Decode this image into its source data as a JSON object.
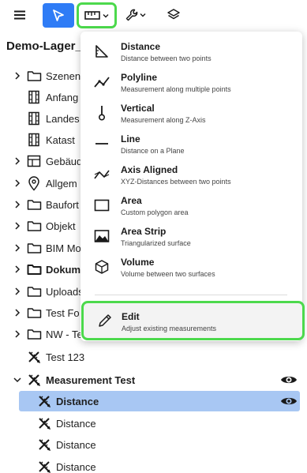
{
  "toolbar": {
    "menu_icon": "hamburger-icon",
    "select_icon": "cursor-arrow-icon",
    "measure_icon": "ruler-icon",
    "tools_icon": "wrench-icon",
    "layers_icon": "layers-icon",
    "accent": "#2f7cf6",
    "highlight": "#4cd94c"
  },
  "project": {
    "title": "Demo-Lager_u"
  },
  "tree": {
    "items": [
      {
        "label": "Szenen",
        "icon": "folder-icon"
      },
      {
        "label": "Anfang",
        "icon": "film-icon"
      },
      {
        "label": "Landes",
        "icon": "film-icon"
      },
      {
        "label": "Katast",
        "icon": "film-icon"
      },
      {
        "label": "Gebäud",
        "icon": "table-icon"
      },
      {
        "label": "Allgem",
        "icon": "location-pin-icon"
      },
      {
        "label": "Baufort",
        "icon": "folder-icon"
      },
      {
        "label": "Objekt",
        "icon": "folder-icon"
      },
      {
        "label": "BIM Mo",
        "icon": "folder-icon"
      },
      {
        "label": "Dokum",
        "icon": "folder-icon"
      },
      {
        "label": "Uploads",
        "icon": "folder-icon"
      },
      {
        "label": "Test Fo",
        "icon": "folder-icon"
      },
      {
        "label": "NW - Te",
        "icon": "folder-icon"
      },
      {
        "label": "Test 123",
        "icon": "measure-tools-icon"
      },
      {
        "label": "Measurement Test",
        "icon": "measure-tools-icon"
      },
      {
        "label": "Distance",
        "icon": "measure-tools-icon"
      },
      {
        "label": "Distance",
        "icon": "measure-tools-icon"
      },
      {
        "label": "Distance",
        "icon": "measure-tools-icon"
      },
      {
        "label": "Distance",
        "icon": "measure-tools-icon"
      }
    ]
  },
  "dropdown": {
    "items": [
      {
        "title": "Distance",
        "desc": "Distance between two points",
        "icon": "distance-icon"
      },
      {
        "title": "Polyline",
        "desc": "Measurement along multiple points",
        "icon": "polyline-icon"
      },
      {
        "title": "Vertical",
        "desc": "Measurement along Z-Axis",
        "icon": "vertical-icon"
      },
      {
        "title": "Line",
        "desc": "Distance on a Plane",
        "icon": "line-icon"
      },
      {
        "title": "Axis Aligned",
        "desc": "XYZ-Distances between two points",
        "icon": "axis-aligned-icon"
      },
      {
        "title": "Area",
        "desc": "Custom polygon area",
        "icon": "area-icon"
      },
      {
        "title": "Area Strip",
        "desc": "Triangularized surface",
        "icon": "area-strip-icon"
      },
      {
        "title": "Volume",
        "desc": "Volume between two surfaces",
        "icon": "volume-icon"
      }
    ],
    "edit": {
      "title": "Edit",
      "desc": "Adjust existing measurements",
      "icon": "pencil-icon"
    }
  }
}
